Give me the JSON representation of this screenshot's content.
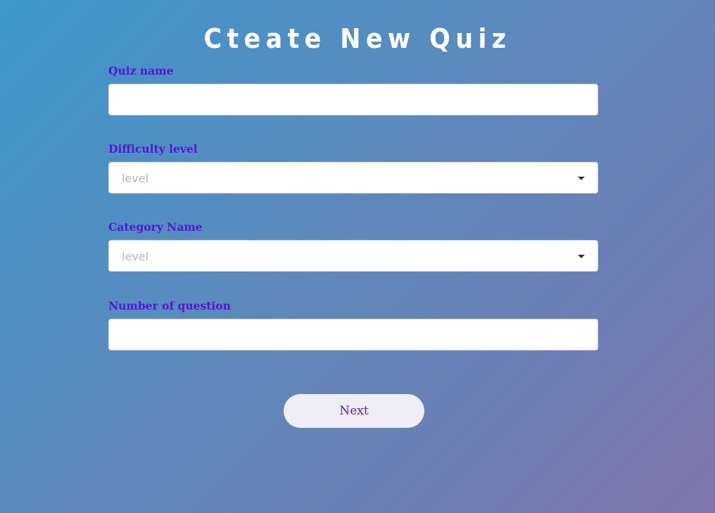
{
  "page": {
    "title": "Cteate New Quiz"
  },
  "form": {
    "quiz_name": {
      "label": "Quiz name",
      "value": ""
    },
    "difficulty": {
      "label": "Difficulty level",
      "selected": "level"
    },
    "category": {
      "label": "Category Name",
      "selected": "level"
    },
    "num_questions": {
      "label": "Number of question",
      "value": ""
    },
    "next_label": "Next"
  },
  "colors": {
    "label": "#5a14d6",
    "button_text": "#5a1fb5",
    "button_bg": "#efedf5",
    "gradient_start": "#3c98cc",
    "gradient_end": "#7f77ae"
  },
  "icons": {
    "select_caret": "caret-down-icon"
  }
}
